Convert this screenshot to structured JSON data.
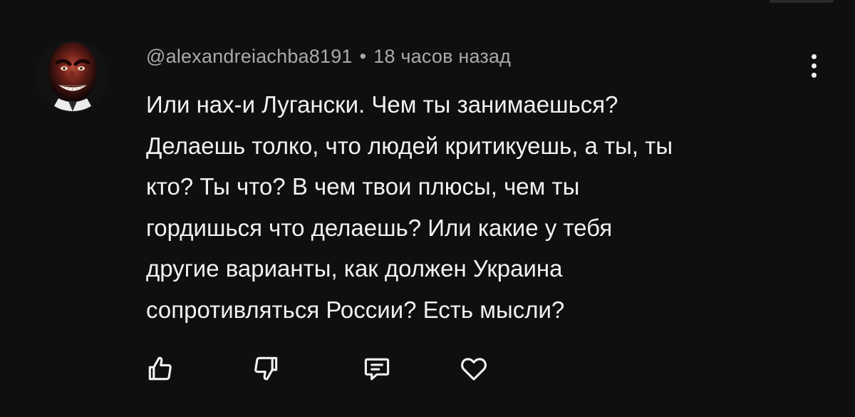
{
  "comment": {
    "author": "@alexandreiachba8191",
    "separator": "•",
    "time_ago": "18 часов назад",
    "text_lines": [
      "Или нах-и Лугански. Чем ты занимаешься?",
      "Делаешь толко, что людей критикуешь, а ты, ты",
      "кто? Ты что? В чем твои плюсы, чем ты",
      "гордишься что делаешь? Или какие у тебя",
      "другие варианты, как должен Украина",
      "сопротивляться России? Есть мысли?"
    ]
  },
  "actions": {
    "like_icon": "thumbs-up-icon",
    "dislike_icon": "thumbs-down-icon",
    "reply_icon": "comment-reply-icon",
    "heart_icon": "heart-icon"
  },
  "menu": {
    "icon": "more-vertical-icon"
  },
  "colors": {
    "background": "#0f0f0f",
    "primary_text": "#f1f1f1",
    "secondary_text": "#aaaaaa"
  }
}
